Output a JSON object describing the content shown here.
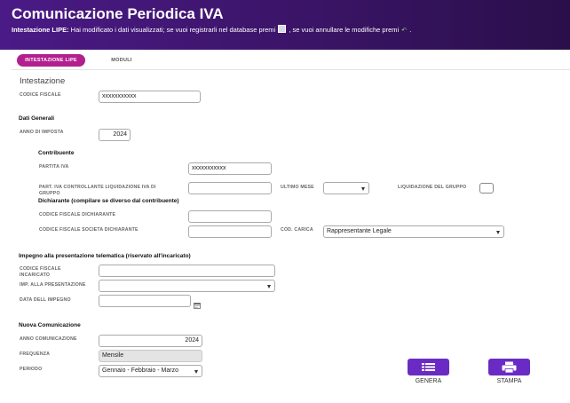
{
  "header": {
    "title": "Comunicazione Periodica IVA",
    "notice_bold": "Intestazione LIPE:",
    "notice_text1": " Hai modificato i dati visualizzati; se vuoi registrarli nel database premi ",
    "notice_text2": " , se vuoi annullare le modifiche premi ",
    "notice_text3": " ."
  },
  "tabs": [
    {
      "label": "INTESTAZIONE LIPE",
      "active": true
    },
    {
      "label": "MODULI",
      "active": false
    }
  ],
  "intestazione": {
    "heading": "Intestazione",
    "codice_fiscale_label": "CODICE FISCALE",
    "codice_fiscale_value": "xxxxxxxxxxx"
  },
  "dati_generali": {
    "heading": "Dati Generali",
    "anno_label": "ANNO DI IMPOSTA",
    "anno_value": "2024",
    "contribuente_heading": "Contribuente",
    "partita_iva_label": "PARTITA IVA",
    "partita_iva_value": "xxxxxxxxxxx",
    "part_iva_controllante_label1": "PART. IVA CONTROLLANTE LIQUIDAZIONE IVA DI",
    "part_iva_controllante_label2": "GRUPPO",
    "part_iva_controllante_value": "",
    "ultimo_mese_label": "ULTIMO MESE",
    "ultimo_mese_value": "",
    "liquidazione_gruppo_label": "LIQUIDAZIONE DEL GRUPPO",
    "dichiarante_heading": "Dichiarante (compilare se diverso dal contribuente)",
    "cf_dichiarante_label": "CODICE FISCALE DICHIARANTE",
    "cf_dichiarante_value": "",
    "cf_societa_label": "CODICE FISCALE SOCIETA DICHIARANTE",
    "cf_societa_value": "",
    "cod_carica_label": "COD. CARICA",
    "cod_carica_value": "Rappresentante Legale"
  },
  "impegno": {
    "heading": "Impegno alla presentazione telematica (riservato all'incaricato)",
    "cf_incaricato_label1": "CODICE FISCALE",
    "cf_incaricato_label2": "INCARICATO",
    "cf_incaricato_value": "",
    "imp_presentazione_label": "IMP. ALLA PRESENTAZIONE",
    "imp_presentazione_value": "",
    "data_impegno_label": "DATA DELL IMPEGNO",
    "data_impegno_value": ""
  },
  "nuova": {
    "heading": "Nuova Comunicazione",
    "anno_label": "ANNO COMUNICAZIONE",
    "anno_value": "2024",
    "frequenza_label": "FREQUENZA",
    "frequenza_value": "Mensile",
    "periodo_label": "PERIODO",
    "periodo_value": "Gennaio - Febbraio - Marzo"
  },
  "actions": {
    "genera_label": "GENERA",
    "stampa_label": "STAMPA"
  },
  "colors": {
    "header": "#3a1466",
    "tab_active": "#b31f8f",
    "button": "#6a2bc4"
  }
}
